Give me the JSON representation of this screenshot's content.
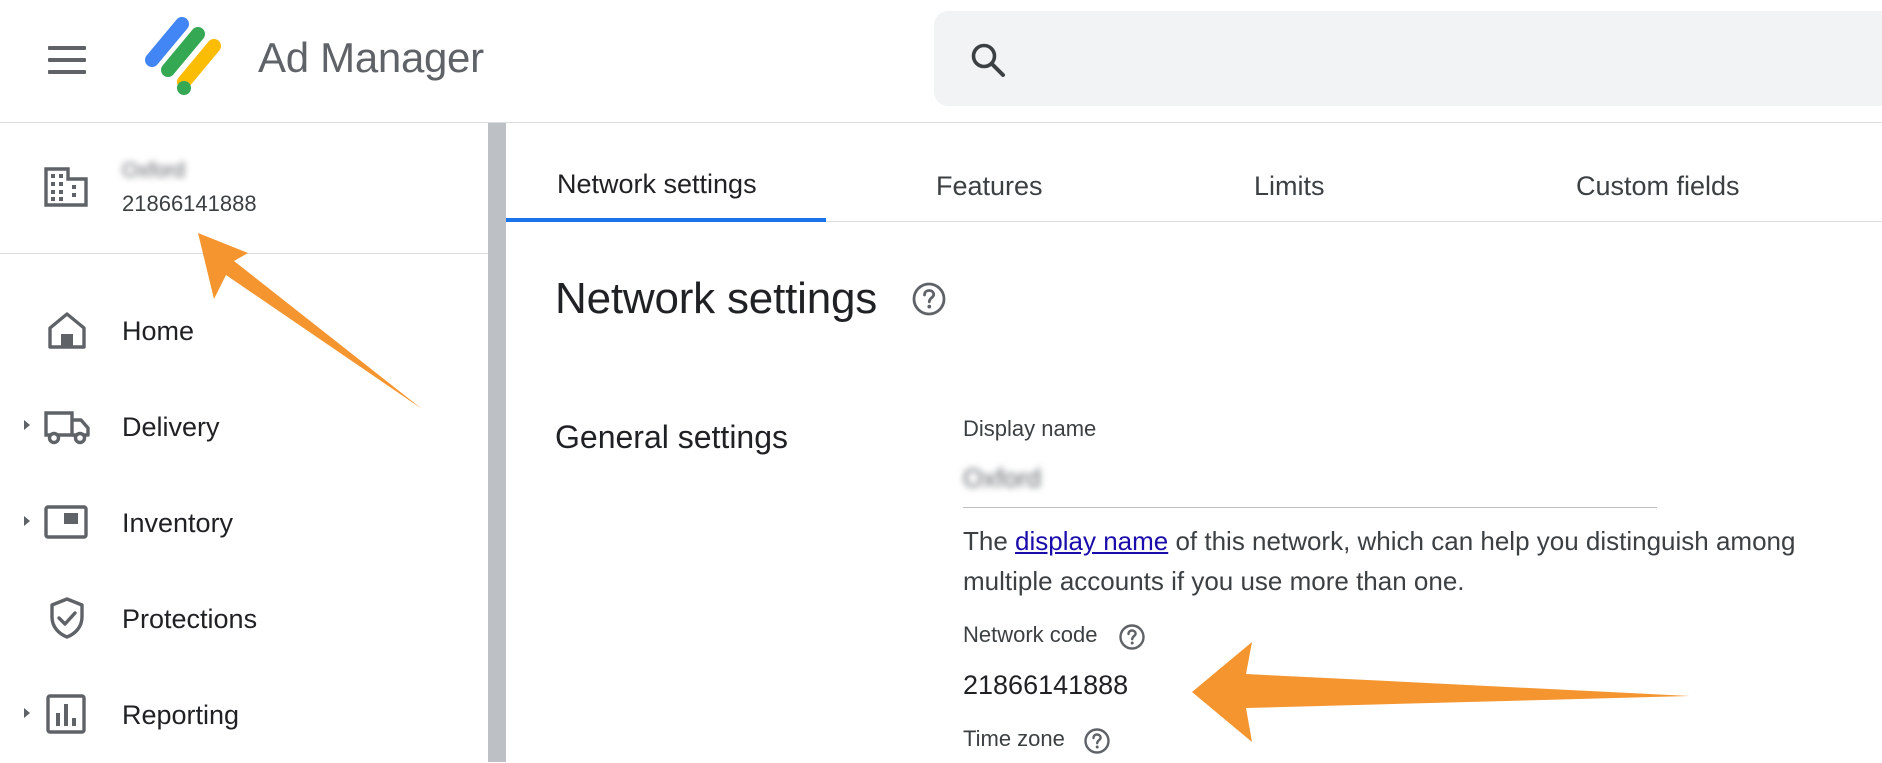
{
  "header": {
    "app_title": "Ad Manager",
    "search_placeholder": "",
    "logo_colors": [
      "#4285f4",
      "#34a853",
      "#fbbc04"
    ]
  },
  "account": {
    "name": "Oxford",
    "network_id": "21866141888"
  },
  "sidebar": {
    "items": [
      {
        "label": "Home",
        "icon": "home-icon",
        "expandable": false
      },
      {
        "label": "Delivery",
        "icon": "truck-icon",
        "expandable": true
      },
      {
        "label": "Inventory",
        "icon": "inventory-icon",
        "expandable": true
      },
      {
        "label": "Protections",
        "icon": "shield-check-icon",
        "expandable": false
      },
      {
        "label": "Reporting",
        "icon": "bar-chart-icon",
        "expandable": true
      }
    ]
  },
  "tabs": [
    {
      "label": "Network settings",
      "active": true
    },
    {
      "label": "Features",
      "active": false
    },
    {
      "label": "Limits",
      "active": false
    },
    {
      "label": "Custom fields",
      "active": false
    }
  ],
  "page": {
    "title": "Network settings",
    "section_title": "General settings",
    "display_name_label": "Display name",
    "display_name_value": "Oxford",
    "display_name_desc_before": "The ",
    "display_name_link": "display name",
    "display_name_desc_after": " of this network, which can help you distinguish among multiple accounts if you use more than one.",
    "network_code_label": "Network code",
    "network_code_value": "21866141888",
    "time_zone_label": "Time zone"
  },
  "colors": {
    "accent": "#1a73e8",
    "annotation_arrow": "#f5952f",
    "link": "#1a0dab"
  }
}
